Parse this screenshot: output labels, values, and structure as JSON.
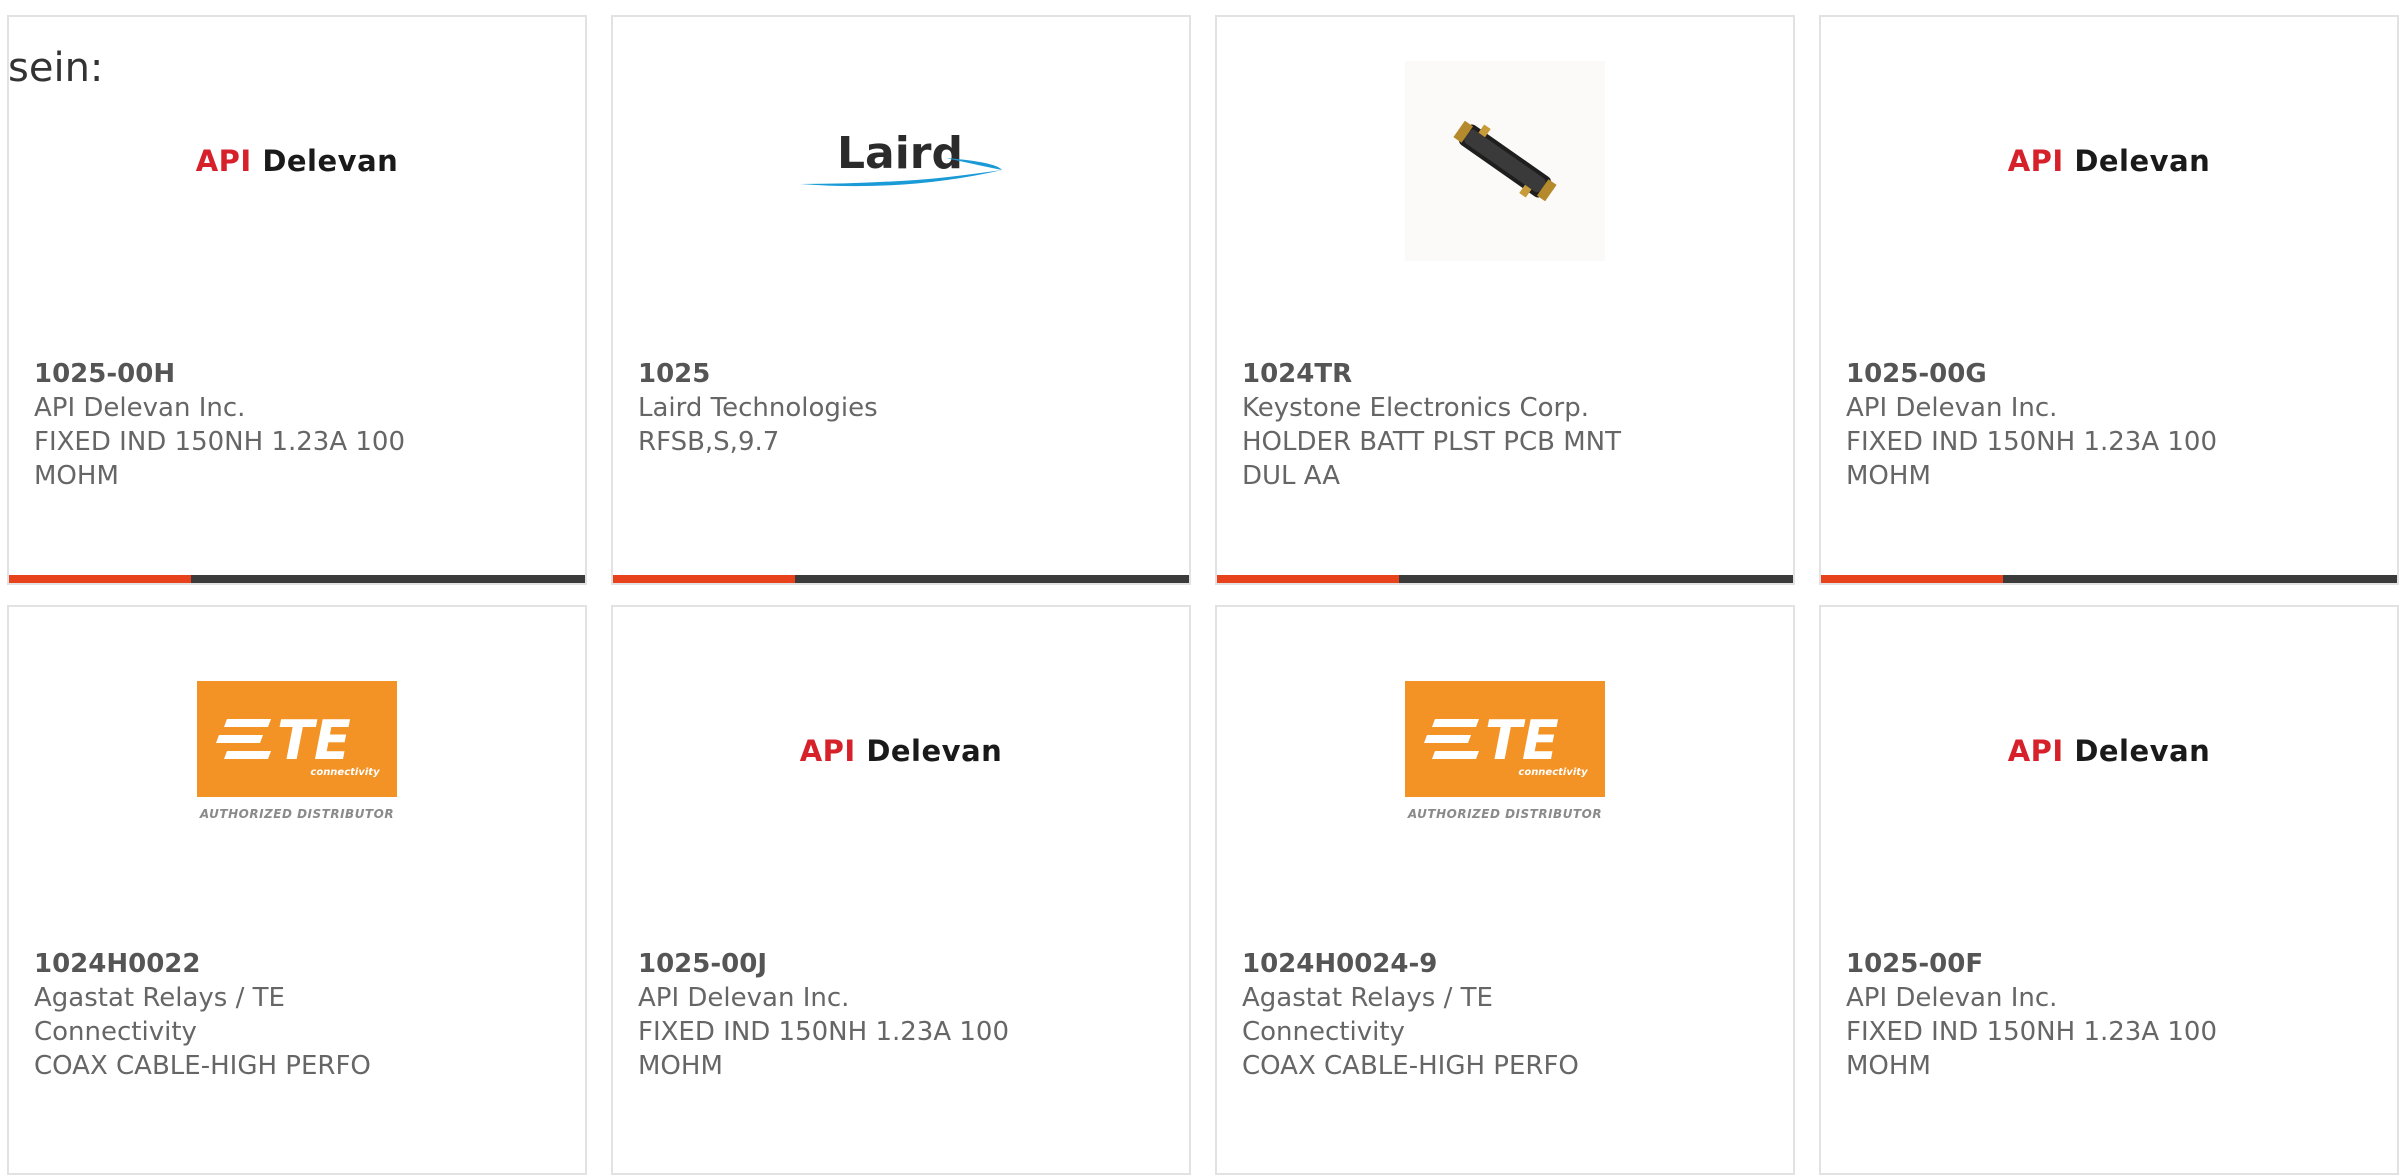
{
  "prefix_text": "sein:",
  "cards": [
    {
      "part_number": "1025-00H",
      "manufacturer": "API Delevan Inc.",
      "description_line1": "FIXED IND 150NH 1.23A 100",
      "description_line2": "MOHM",
      "logo": "api-delevan",
      "logo_text_a": "API",
      "logo_text_b": "Delevan"
    },
    {
      "part_number": "1025",
      "manufacturer": "Laird Technologies",
      "description_line1": "RFSB,S,9.7",
      "description_line2": "",
      "logo": "laird",
      "logo_text_a": "Laird"
    },
    {
      "part_number": "1024TR",
      "manufacturer": "Keystone Electronics Corp.",
      "description_line1": "HOLDER BATT PLST PCB MNT",
      "description_line2": "DUL AA",
      "logo": "product-photo"
    },
    {
      "part_number": "1025-00G",
      "manufacturer": "API Delevan Inc.",
      "description_line1": "FIXED IND 150NH 1.23A 100",
      "description_line2": "MOHM",
      "logo": "api-delevan",
      "logo_text_a": "API",
      "logo_text_b": "Delevan"
    },
    {
      "part_number": "1024H0022",
      "manufacturer": "Agastat Relays / TE Connectivity",
      "description_line1": "COAX CABLE-HIGH PERFO",
      "description_line2": "",
      "logo": "te",
      "logo_text_a": "TE",
      "logo_text_b": "connectivity",
      "logo_text_c": "AUTHORIZED DISTRIBUTOR"
    },
    {
      "part_number": "1025-00J",
      "manufacturer": "API Delevan Inc.",
      "description_line1": "FIXED IND 150NH 1.23A 100",
      "description_line2": "MOHM",
      "logo": "api-delevan",
      "logo_text_a": "API",
      "logo_text_b": "Delevan"
    },
    {
      "part_number": "1024H0024-9",
      "manufacturer": "Agastat Relays / TE Connectivity",
      "description_line1": "COAX CABLE-HIGH PERFO",
      "description_line2": "",
      "logo": "te",
      "logo_text_a": "TE",
      "logo_text_b": "connectivity",
      "logo_text_c": "AUTHORIZED DISTRIBUTOR"
    },
    {
      "part_number": "1025-00F",
      "manufacturer": "API Delevan Inc.",
      "description_line1": "FIXED IND 150NH 1.23A 100",
      "description_line2": "MOHM",
      "logo": "api-delevan",
      "logo_text_a": "API",
      "logo_text_b": "Delevan"
    }
  ],
  "colors": {
    "accent": "#e8421c",
    "bar_dark": "#3a3a3a",
    "api_red": "#d6202a",
    "te_orange": "#f39325",
    "laird_blue": "#1a9ad6"
  }
}
